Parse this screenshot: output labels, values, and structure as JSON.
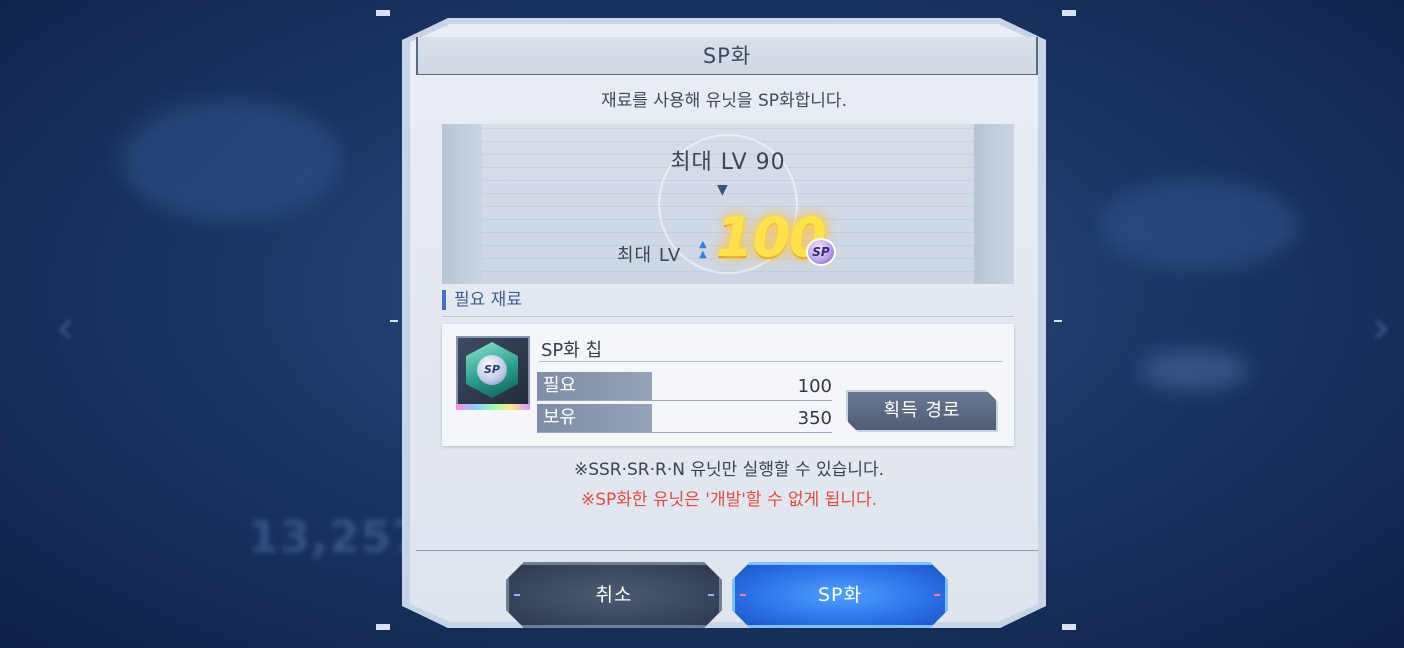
{
  "dialog": {
    "title": "SP화",
    "subtitle": "재료를 사용해 유닛을 SP화합니다."
  },
  "level": {
    "current_label": "최대 LV 90",
    "new_label": "최대 LV",
    "new_value": "100",
    "badge": "SP"
  },
  "materials": {
    "section_title": "필요 재료",
    "item_name": "SP화 칩",
    "item_icon_text": "SP",
    "required_label": "필요",
    "required_value": "100",
    "owned_label": "보유",
    "owned_value": "350",
    "acquire_button": "획득 경로"
  },
  "notes": {
    "line1": "※SSR·SR·R·N 유닛만 실행할 수 있습니다.",
    "line2": "※SP화한 유닛은 '개발'할 수 없게 됩니다."
  },
  "buttons": {
    "cancel": "취소",
    "confirm": "SP화"
  },
  "background": {
    "blurred_number": "13,257"
  },
  "colors": {
    "accent_blue": "#2a6fe6",
    "warning_red": "#e24c42",
    "level_gold": "#ffe34d"
  }
}
